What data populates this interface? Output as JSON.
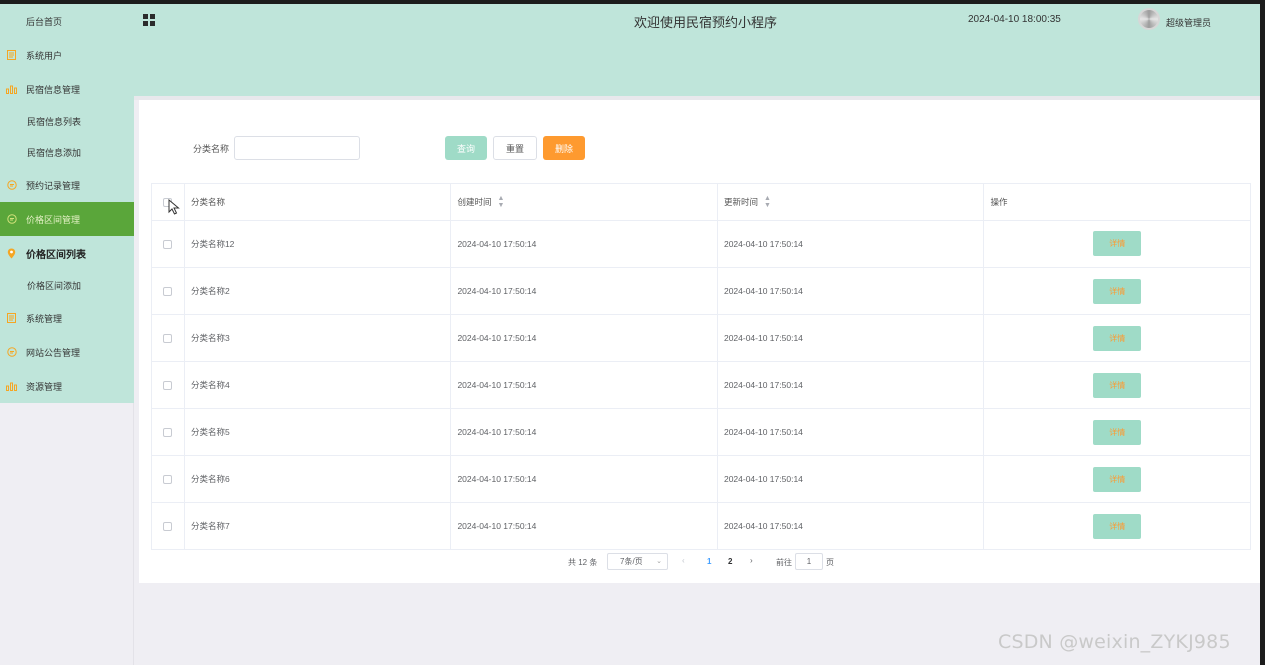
{
  "header": {
    "title": "欢迎使用民宿预约小程序",
    "datetime": "2024-04-10 18:00:35",
    "username": "超级管理员"
  },
  "sidebar": {
    "items": [
      {
        "label": "后台首页",
        "icon": "none"
      },
      {
        "label": "系统用户",
        "icon": "document-icon"
      },
      {
        "label": "民宿信息管理",
        "icon": "bar-chart-icon"
      },
      {
        "label": "民宿信息列表",
        "icon": "none"
      },
      {
        "label": "民宿信息添加",
        "icon": "none"
      },
      {
        "label": "预约记录管理",
        "icon": "chat-bubble-icon"
      },
      {
        "label": "价格区间管理",
        "icon": "chat-bubble-icon"
      },
      {
        "label": "价格区间列表",
        "icon": "location-pin-icon"
      },
      {
        "label": "价格区间添加",
        "icon": "none"
      },
      {
        "label": "系统管理",
        "icon": "document-icon"
      },
      {
        "label": "网站公告管理",
        "icon": "chat-bubble-icon"
      },
      {
        "label": "资源管理",
        "icon": "bar-chart-icon"
      }
    ],
    "active_group_color": "#5aa63a",
    "menu_bg_color": "#bfe5da"
  },
  "filter": {
    "label": "分类名称",
    "input_value": "",
    "search_label": "查询",
    "reset_label": "重置",
    "delete_label": "删除"
  },
  "table": {
    "headers": [
      "分类名称",
      "创建时间",
      "更新时间",
      "操作"
    ],
    "rows": [
      {
        "name": "分类名称12",
        "created": "2024-04-10 17:50:14",
        "updated": "2024-04-10 17:50:14",
        "action": "详情"
      },
      {
        "name": "分类名称2",
        "created": "2024-04-10 17:50:14",
        "updated": "2024-04-10 17:50:14",
        "action": "详情"
      },
      {
        "name": "分类名称3",
        "created": "2024-04-10 17:50:14",
        "updated": "2024-04-10 17:50:14",
        "action": "详情"
      },
      {
        "name": "分类名称4",
        "created": "2024-04-10 17:50:14",
        "updated": "2024-04-10 17:50:14",
        "action": "详情"
      },
      {
        "name": "分类名称5",
        "created": "2024-04-10 17:50:14",
        "updated": "2024-04-10 17:50:14",
        "action": "详情"
      },
      {
        "name": "分类名称6",
        "created": "2024-04-10 17:50:14",
        "updated": "2024-04-10 17:50:14",
        "action": "详情"
      },
      {
        "name": "分类名称7",
        "created": "2024-04-10 17:50:14",
        "updated": "2024-04-10 17:50:14",
        "action": "详情"
      }
    ]
  },
  "pagination": {
    "total": "共 12 条",
    "page_size": "7条/页",
    "pages": [
      "1",
      "2"
    ],
    "current_page": "1",
    "goto_label": "前往",
    "goto_value": "1",
    "page_unit": "页"
  },
  "colors": {
    "accent": "#9fdbc7",
    "danger": "#fe9a2f",
    "header_bg": "#bfe5da"
  },
  "watermark": "CSDN @weixin_ZYKJ985"
}
